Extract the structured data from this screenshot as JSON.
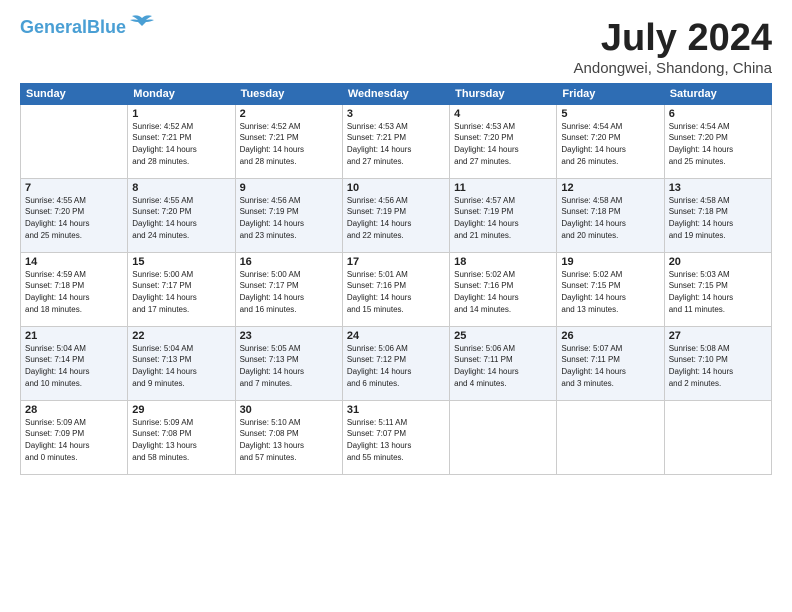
{
  "header": {
    "logo_line1": "General",
    "logo_line2": "Blue",
    "month": "July 2024",
    "location": "Andongwei, Shandong, China"
  },
  "days_of_week": [
    "Sunday",
    "Monday",
    "Tuesday",
    "Wednesday",
    "Thursday",
    "Friday",
    "Saturday"
  ],
  "weeks": [
    [
      {
        "day": "",
        "info": ""
      },
      {
        "day": "1",
        "info": "Sunrise: 4:52 AM\nSunset: 7:21 PM\nDaylight: 14 hours\nand 28 minutes."
      },
      {
        "day": "2",
        "info": "Sunrise: 4:52 AM\nSunset: 7:21 PM\nDaylight: 14 hours\nand 28 minutes."
      },
      {
        "day": "3",
        "info": "Sunrise: 4:53 AM\nSunset: 7:21 PM\nDaylight: 14 hours\nand 27 minutes."
      },
      {
        "day": "4",
        "info": "Sunrise: 4:53 AM\nSunset: 7:20 PM\nDaylight: 14 hours\nand 27 minutes."
      },
      {
        "day": "5",
        "info": "Sunrise: 4:54 AM\nSunset: 7:20 PM\nDaylight: 14 hours\nand 26 minutes."
      },
      {
        "day": "6",
        "info": "Sunrise: 4:54 AM\nSunset: 7:20 PM\nDaylight: 14 hours\nand 25 minutes."
      }
    ],
    [
      {
        "day": "7",
        "info": "Sunrise: 4:55 AM\nSunset: 7:20 PM\nDaylight: 14 hours\nand 25 minutes."
      },
      {
        "day": "8",
        "info": "Sunrise: 4:55 AM\nSunset: 7:20 PM\nDaylight: 14 hours\nand 24 minutes."
      },
      {
        "day": "9",
        "info": "Sunrise: 4:56 AM\nSunset: 7:19 PM\nDaylight: 14 hours\nand 23 minutes."
      },
      {
        "day": "10",
        "info": "Sunrise: 4:56 AM\nSunset: 7:19 PM\nDaylight: 14 hours\nand 22 minutes."
      },
      {
        "day": "11",
        "info": "Sunrise: 4:57 AM\nSunset: 7:19 PM\nDaylight: 14 hours\nand 21 minutes."
      },
      {
        "day": "12",
        "info": "Sunrise: 4:58 AM\nSunset: 7:18 PM\nDaylight: 14 hours\nand 20 minutes."
      },
      {
        "day": "13",
        "info": "Sunrise: 4:58 AM\nSunset: 7:18 PM\nDaylight: 14 hours\nand 19 minutes."
      }
    ],
    [
      {
        "day": "14",
        "info": "Sunrise: 4:59 AM\nSunset: 7:18 PM\nDaylight: 14 hours\nand 18 minutes."
      },
      {
        "day": "15",
        "info": "Sunrise: 5:00 AM\nSunset: 7:17 PM\nDaylight: 14 hours\nand 17 minutes."
      },
      {
        "day": "16",
        "info": "Sunrise: 5:00 AM\nSunset: 7:17 PM\nDaylight: 14 hours\nand 16 minutes."
      },
      {
        "day": "17",
        "info": "Sunrise: 5:01 AM\nSunset: 7:16 PM\nDaylight: 14 hours\nand 15 minutes."
      },
      {
        "day": "18",
        "info": "Sunrise: 5:02 AM\nSunset: 7:16 PM\nDaylight: 14 hours\nand 14 minutes."
      },
      {
        "day": "19",
        "info": "Sunrise: 5:02 AM\nSunset: 7:15 PM\nDaylight: 14 hours\nand 13 minutes."
      },
      {
        "day": "20",
        "info": "Sunrise: 5:03 AM\nSunset: 7:15 PM\nDaylight: 14 hours\nand 11 minutes."
      }
    ],
    [
      {
        "day": "21",
        "info": "Sunrise: 5:04 AM\nSunset: 7:14 PM\nDaylight: 14 hours\nand 10 minutes."
      },
      {
        "day": "22",
        "info": "Sunrise: 5:04 AM\nSunset: 7:13 PM\nDaylight: 14 hours\nand 9 minutes."
      },
      {
        "day": "23",
        "info": "Sunrise: 5:05 AM\nSunset: 7:13 PM\nDaylight: 14 hours\nand 7 minutes."
      },
      {
        "day": "24",
        "info": "Sunrise: 5:06 AM\nSunset: 7:12 PM\nDaylight: 14 hours\nand 6 minutes."
      },
      {
        "day": "25",
        "info": "Sunrise: 5:06 AM\nSunset: 7:11 PM\nDaylight: 14 hours\nand 4 minutes."
      },
      {
        "day": "26",
        "info": "Sunrise: 5:07 AM\nSunset: 7:11 PM\nDaylight: 14 hours\nand 3 minutes."
      },
      {
        "day": "27",
        "info": "Sunrise: 5:08 AM\nSunset: 7:10 PM\nDaylight: 14 hours\nand 2 minutes."
      }
    ],
    [
      {
        "day": "28",
        "info": "Sunrise: 5:09 AM\nSunset: 7:09 PM\nDaylight: 14 hours\nand 0 minutes."
      },
      {
        "day": "29",
        "info": "Sunrise: 5:09 AM\nSunset: 7:08 PM\nDaylight: 13 hours\nand 58 minutes."
      },
      {
        "day": "30",
        "info": "Sunrise: 5:10 AM\nSunset: 7:08 PM\nDaylight: 13 hours\nand 57 minutes."
      },
      {
        "day": "31",
        "info": "Sunrise: 5:11 AM\nSunset: 7:07 PM\nDaylight: 13 hours\nand 55 minutes."
      },
      {
        "day": "",
        "info": ""
      },
      {
        "day": "",
        "info": ""
      },
      {
        "day": "",
        "info": ""
      }
    ]
  ]
}
